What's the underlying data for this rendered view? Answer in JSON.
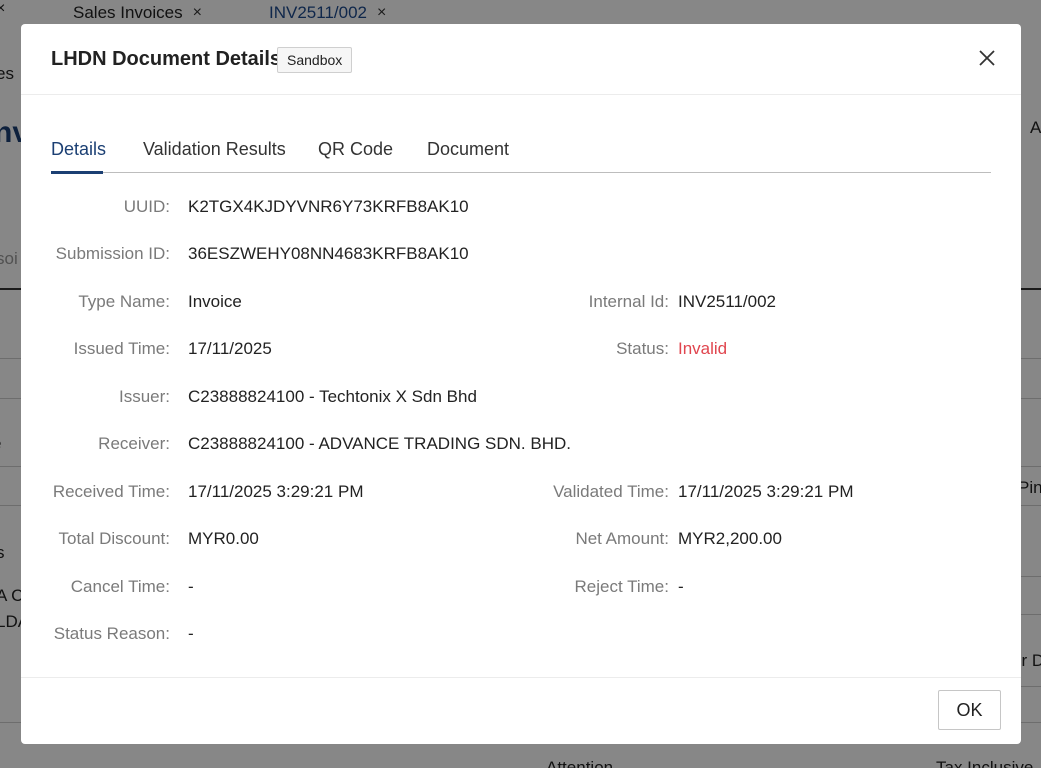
{
  "background": {
    "tabs": [
      {
        "label": "Sales Invoices",
        "close": "×"
      },
      {
        "label": "INV2511/002",
        "close": "×"
      }
    ],
    "fragments": [
      "×",
      "es",
      "nv",
      "A",
      "soi",
      "e",
      "Pin",
      "s",
      "A C",
      "LDA",
      "ur D",
      "Attention",
      "Tax Inclusive"
    ]
  },
  "modal": {
    "title": "LHDN Document Details",
    "badge": "Sandbox",
    "tabs": [
      "Details",
      "Validation Results",
      "QR Code",
      "Document"
    ],
    "active_tab": "Details",
    "separator": ":",
    "fields": {
      "uuid": {
        "label": "UUID",
        "value": "K2TGX4KJDYVNR6Y73KRFB8AK10"
      },
      "submission_id": {
        "label": "Submission ID",
        "value": "36ESZWEHY08NN4683KRFB8AK10"
      },
      "type_name": {
        "label": "Type Name",
        "value": "Invoice"
      },
      "internal_id": {
        "label": "Internal Id",
        "value": "INV2511/002"
      },
      "issued_time": {
        "label": "Issued Time",
        "value": "17/11/2025"
      },
      "status": {
        "label": "Status",
        "value": "Invalid"
      },
      "issuer": {
        "label": "Issuer",
        "value": "C23888824100 - Techtonix X Sdn Bhd"
      },
      "receiver": {
        "label": "Receiver",
        "value": "C23888824100 - ADVANCE TRADING SDN. BHD."
      },
      "received_time": {
        "label": "Received Time",
        "value": "17/11/2025 3:29:21 PM"
      },
      "validated_time": {
        "label": "Validated Time",
        "value": "17/11/2025 3:29:21 PM"
      },
      "total_discount": {
        "label": "Total Discount",
        "value": "MYR0.00"
      },
      "net_amount": {
        "label": "Net Amount",
        "value": "MYR2,200.00"
      },
      "cancel_time": {
        "label": "Cancel Time",
        "value": "-"
      },
      "reject_time": {
        "label": "Reject Time",
        "value": "-"
      },
      "status_reason": {
        "label": "Status Reason",
        "value": "-"
      }
    },
    "ok_label": "OK",
    "colors": {
      "accent": "#1b3f73",
      "invalid": "#e0454e"
    }
  }
}
